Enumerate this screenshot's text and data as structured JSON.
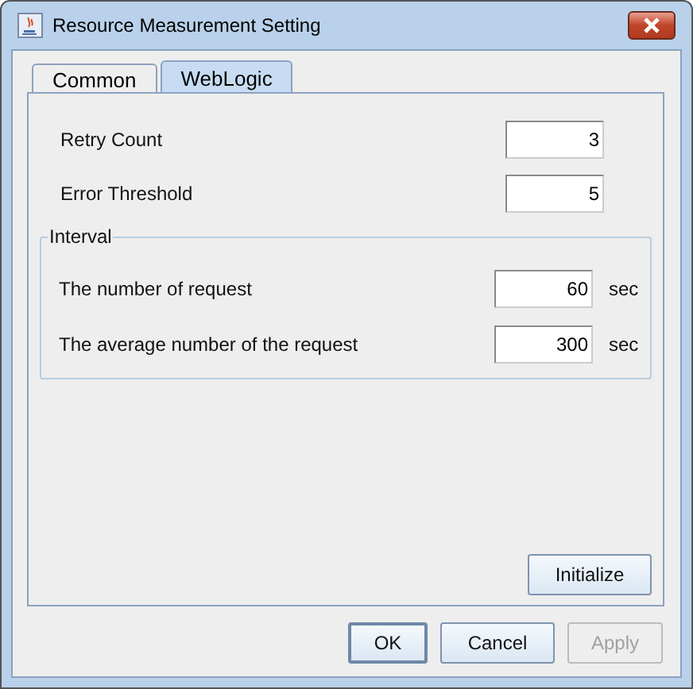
{
  "window": {
    "title": "Resource Measurement Setting"
  },
  "tabs": [
    {
      "label": "Common",
      "selected": false
    },
    {
      "label": "WebLogic",
      "selected": true
    }
  ],
  "fields": [
    {
      "label": "Retry Count",
      "value": "3"
    },
    {
      "label": "Error Threshold",
      "value": "5"
    }
  ],
  "interval": {
    "title": "Interval",
    "fields": [
      {
        "label": "The number of request",
        "value": "60",
        "unit": "sec"
      },
      {
        "label": "The average number of the request",
        "value": "300",
        "unit": "sec"
      }
    ]
  },
  "panel_button": {
    "label": "Initialize"
  },
  "buttons": [
    {
      "label": "OK",
      "disabled": false,
      "default": true
    },
    {
      "label": "Cancel",
      "disabled": false,
      "default": false
    },
    {
      "label": "Apply",
      "disabled": true,
      "default": false
    }
  ]
}
